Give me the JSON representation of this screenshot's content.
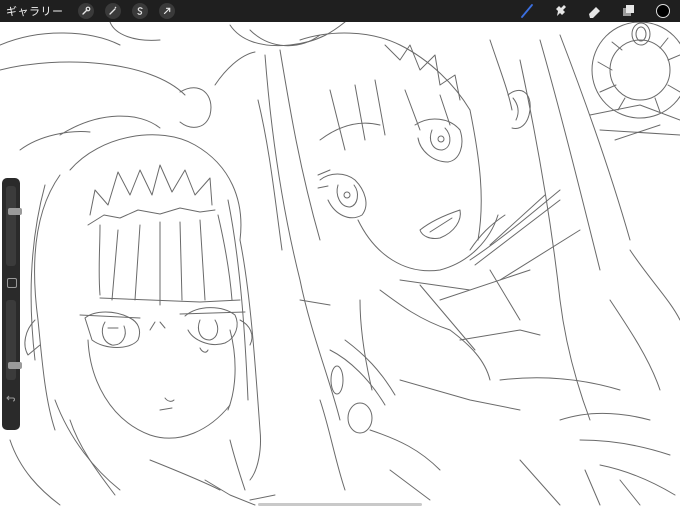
{
  "toolbar": {
    "gallery_label": "ギャラリー",
    "left_icons": [
      "wrench-icon",
      "magic-wand-icon",
      "selection-icon",
      "transform-arrow-icon"
    ],
    "right_tools": [
      "brush-icon",
      "smudge-icon",
      "eraser-icon",
      "layers-icon"
    ],
    "active_tool": "brush-icon",
    "active_tool_color": "#3b6fe0",
    "current_color": "#000000"
  },
  "sidebar": {
    "brush_size_level": 0.3,
    "opacity_level": 0.85
  },
  "canvas": {
    "sketch_stroke_color": "#6a6a6a",
    "background": "#ffffff"
  }
}
